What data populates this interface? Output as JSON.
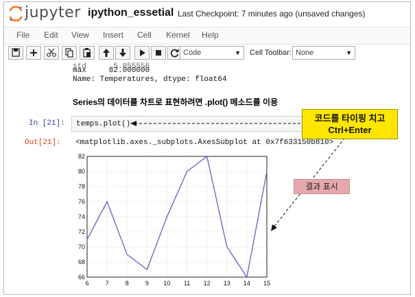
{
  "header": {
    "brand": "jupyter",
    "notebook_name": "ipython_essetial",
    "checkpoint": "Last Checkpoint: 7 minutes ago (unsaved changes)"
  },
  "menu": {
    "items": [
      "File",
      "Edit",
      "View",
      "Insert",
      "Cell",
      "Kernel",
      "Help"
    ]
  },
  "toolbar": {
    "cell_type": "Code",
    "cell_toolbar_label": "Cell Toolbar:",
    "cell_toolbar_value": "None"
  },
  "cells": {
    "prev_output_lines": [
      "max     82.000000",
      "Name: Temperatures, dtype: float64"
    ],
    "heading": "Series의 데이터를 차트로 표현하려면 .plot() 메소드를 이용",
    "in_prompt": "In [21]:",
    "code": "temps.plot()",
    "out_prompt": "Out[21]:",
    "output_text": "<matplotlib.axes._subplots.AxesSubplot at 0x7f633150b810>"
  },
  "callouts": {
    "code_hint": "코드를 타이핑 치고",
    "code_hint_keys": "Ctrl+Enter",
    "result_label": "결과 표시"
  },
  "chart_data": {
    "type": "line",
    "x": [
      6,
      7,
      8,
      9,
      10,
      11,
      12,
      13,
      14,
      15
    ],
    "values": [
      71,
      76,
      69,
      67,
      74,
      80,
      82,
      70,
      66,
      80
    ],
    "xlim": [
      6,
      15
    ],
    "ylim": [
      66,
      82
    ],
    "xticks": [
      6,
      7,
      8,
      9,
      10,
      11,
      12,
      13,
      14,
      15
    ],
    "yticks": [
      66,
      68,
      70,
      72,
      74,
      76,
      78,
      80,
      82
    ],
    "grid": true,
    "line_color": "#6a6ac8"
  }
}
